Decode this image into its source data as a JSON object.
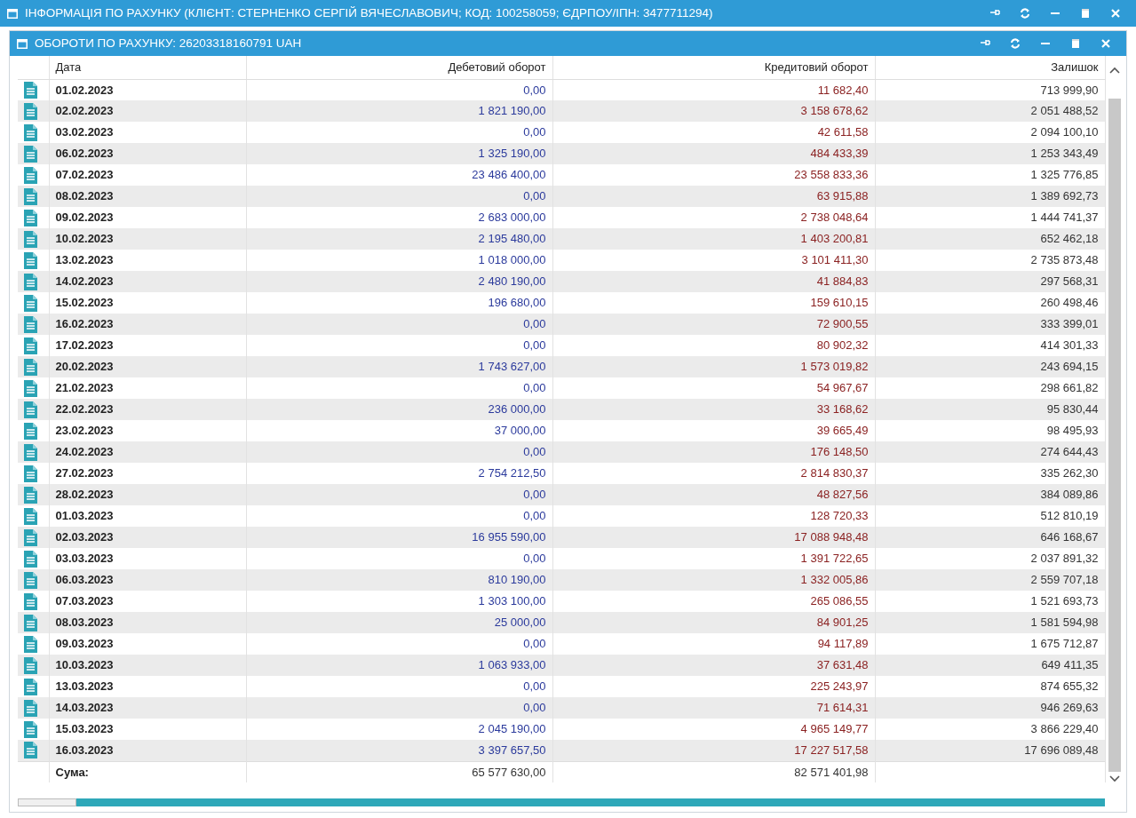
{
  "outer_window": {
    "title": "ІНФОРМАЦІЯ ПО РАХУНКУ (КЛІЄНТ: СТЕРНЕНКО СЕРГІЙ ВЯЧЕСЛАВОВИЧ; КОД: 100258059; ЄДРПОУ/ІПН: 3477711294)"
  },
  "inner_window": {
    "title": "ОБОРОТИ ПО РАХУНКУ: 26203318160791 UAH"
  },
  "table": {
    "columns": [
      "Дата",
      "Дебетовий оборот",
      "Кредитовий оборот",
      "Залишок"
    ],
    "rows": [
      {
        "date": "01.02.2023",
        "debit": "0,00",
        "credit": "11 682,40",
        "balance": "713 999,90"
      },
      {
        "date": "02.02.2023",
        "debit": "1 821 190,00",
        "credit": "3 158 678,62",
        "balance": "2 051 488,52"
      },
      {
        "date": "03.02.2023",
        "debit": "0,00",
        "credit": "42 611,58",
        "balance": "2 094 100,10"
      },
      {
        "date": "06.02.2023",
        "debit": "1 325 190,00",
        "credit": "484 433,39",
        "balance": "1 253 343,49"
      },
      {
        "date": "07.02.2023",
        "debit": "23 486 400,00",
        "credit": "23 558 833,36",
        "balance": "1 325 776,85"
      },
      {
        "date": "08.02.2023",
        "debit": "0,00",
        "credit": "63 915,88",
        "balance": "1 389 692,73"
      },
      {
        "date": "09.02.2023",
        "debit": "2 683 000,00",
        "credit": "2 738 048,64",
        "balance": "1 444 741,37"
      },
      {
        "date": "10.02.2023",
        "debit": "2 195 480,00",
        "credit": "1 403 200,81",
        "balance": "652 462,18"
      },
      {
        "date": "13.02.2023",
        "debit": "1 018 000,00",
        "credit": "3 101 411,30",
        "balance": "2 735 873,48"
      },
      {
        "date": "14.02.2023",
        "debit": "2 480 190,00",
        "credit": "41 884,83",
        "balance": "297 568,31"
      },
      {
        "date": "15.02.2023",
        "debit": "196 680,00",
        "credit": "159 610,15",
        "balance": "260 498,46"
      },
      {
        "date": "16.02.2023",
        "debit": "0,00",
        "credit": "72 900,55",
        "balance": "333 399,01"
      },
      {
        "date": "17.02.2023",
        "debit": "0,00",
        "credit": "80 902,32",
        "balance": "414 301,33"
      },
      {
        "date": "20.02.2023",
        "debit": "1 743 627,00",
        "credit": "1 573 019,82",
        "balance": "243 694,15"
      },
      {
        "date": "21.02.2023",
        "debit": "0,00",
        "credit": "54 967,67",
        "balance": "298 661,82"
      },
      {
        "date": "22.02.2023",
        "debit": "236 000,00",
        "credit": "33 168,62",
        "balance": "95 830,44"
      },
      {
        "date": "23.02.2023",
        "debit": "37 000,00",
        "credit": "39 665,49",
        "balance": "98 495,93"
      },
      {
        "date": "24.02.2023",
        "debit": "0,00",
        "credit": "176 148,50",
        "balance": "274 644,43"
      },
      {
        "date": "27.02.2023",
        "debit": "2 754 212,50",
        "credit": "2 814 830,37",
        "balance": "335 262,30"
      },
      {
        "date": "28.02.2023",
        "debit": "0,00",
        "credit": "48 827,56",
        "balance": "384 089,86"
      },
      {
        "date": "01.03.2023",
        "debit": "0,00",
        "credit": "128 720,33",
        "balance": "512 810,19"
      },
      {
        "date": "02.03.2023",
        "debit": "16 955 590,00",
        "credit": "17 088 948,48",
        "balance": "646 168,67"
      },
      {
        "date": "03.03.2023",
        "debit": "0,00",
        "credit": "1 391 722,65",
        "balance": "2 037 891,32"
      },
      {
        "date": "06.03.2023",
        "debit": "810 190,00",
        "credit": "1 332 005,86",
        "balance": "2 559 707,18"
      },
      {
        "date": "07.03.2023",
        "debit": "1 303 100,00",
        "credit": "265 086,55",
        "balance": "1 521 693,73"
      },
      {
        "date": "08.03.2023",
        "debit": "25 000,00",
        "credit": "84 901,25",
        "balance": "1 581 594,98"
      },
      {
        "date": "09.03.2023",
        "debit": "0,00",
        "credit": "94 117,89",
        "balance": "1 675 712,87"
      },
      {
        "date": "10.03.2023",
        "debit": "1 063 933,00",
        "credit": "37 631,48",
        "balance": "649 411,35"
      },
      {
        "date": "13.03.2023",
        "debit": "0,00",
        "credit": "225 243,97",
        "balance": "874 655,32"
      },
      {
        "date": "14.03.2023",
        "debit": "0,00",
        "credit": "71 614,31",
        "balance": "946 269,63"
      },
      {
        "date": "15.03.2023",
        "debit": "2 045 190,00",
        "credit": "4 965 149,77",
        "balance": "3 866 229,40"
      },
      {
        "date": "16.03.2023",
        "debit": "3 397 657,50",
        "credit": "17 227 517,58",
        "balance": "17 696 089,48"
      }
    ],
    "total": {
      "label": "Сума:",
      "debit": "65 577 630,00",
      "credit": "82 571 401,98"
    }
  }
}
